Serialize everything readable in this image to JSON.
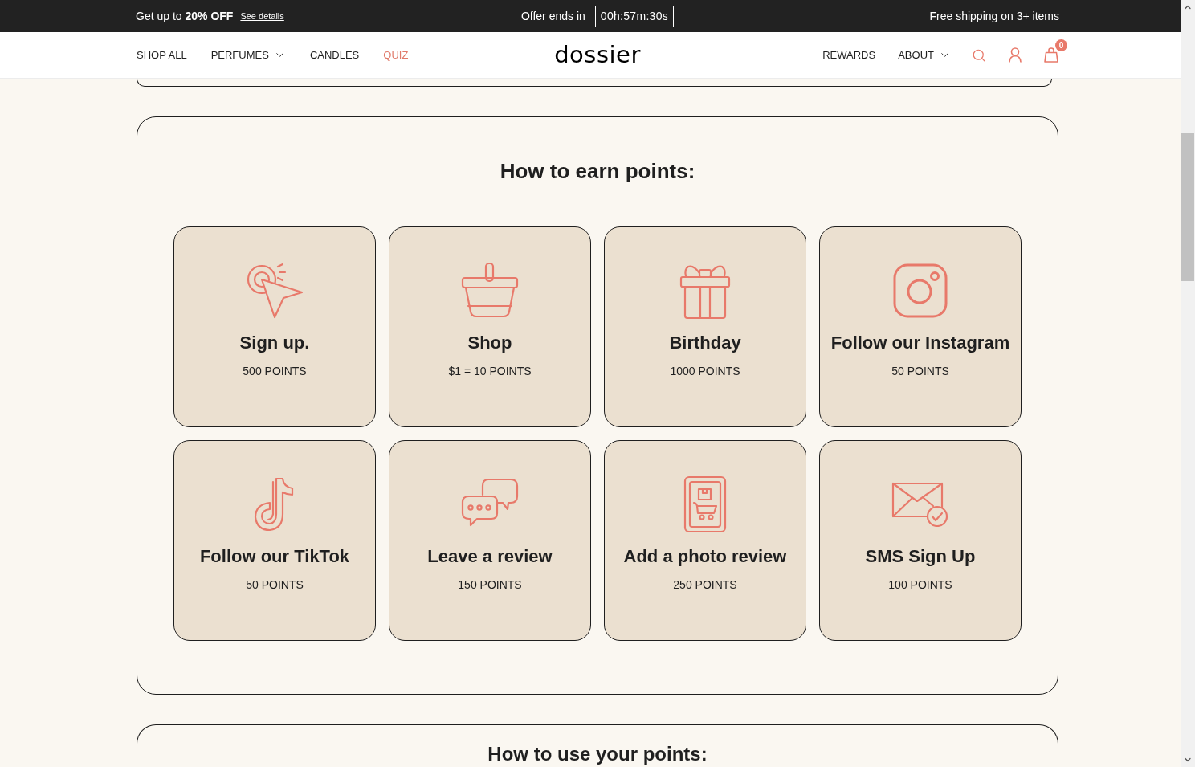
{
  "promo_bar": {
    "offer": "Get up to **20% OFF**",
    "details_link": "See details",
    "countdown_label": "Offer ends in",
    "countdown": "00h:57m:30s",
    "shipping": "Free shipping on 3+ items"
  },
  "nav": {
    "left_items": [
      {
        "label": "SHOP ALL",
        "dropdown": false,
        "highlighted": false
      },
      {
        "label": "PERFUMES",
        "dropdown": true,
        "highlighted": false
      },
      {
        "label": "CANDLES",
        "dropdown": false,
        "highlighted": false
      },
      {
        "label": "QUIZ",
        "dropdown": false,
        "highlighted": true
      }
    ],
    "logo": "dossier",
    "right_items": [
      {
        "label": "REWARDS",
        "dropdown": false,
        "highlighted": false
      },
      {
        "label": "ABOUT",
        "dropdown": true,
        "highlighted": false
      }
    ],
    "cart_count": "0"
  },
  "earn_section": {
    "title": "How to earn points:",
    "ways": [
      {
        "kind": "signup",
        "title": "Sign up.",
        "points": "500 POINTS"
      },
      {
        "kind": "shop",
        "title": "Shop",
        "points": "$1 = 10 POINTS"
      },
      {
        "kind": "birthday",
        "title": "Birthday",
        "points": "1000 POINTS"
      },
      {
        "kind": "instagram",
        "title": "Follow our Instagram",
        "points": "50 POINTS"
      },
      {
        "kind": "tiktok",
        "title": "Follow our TikTok",
        "points": "50 POINTS"
      },
      {
        "kind": "review",
        "title": "Leave a review",
        "points": "150 POINTS"
      },
      {
        "kind": "photo",
        "title": "Add a photo review",
        "points": "250 POINTS"
      },
      {
        "kind": "sms",
        "title": "SMS Sign Up",
        "points": "100 POINTS"
      }
    ]
  },
  "use_section": {
    "title": "How to use your points:"
  }
}
